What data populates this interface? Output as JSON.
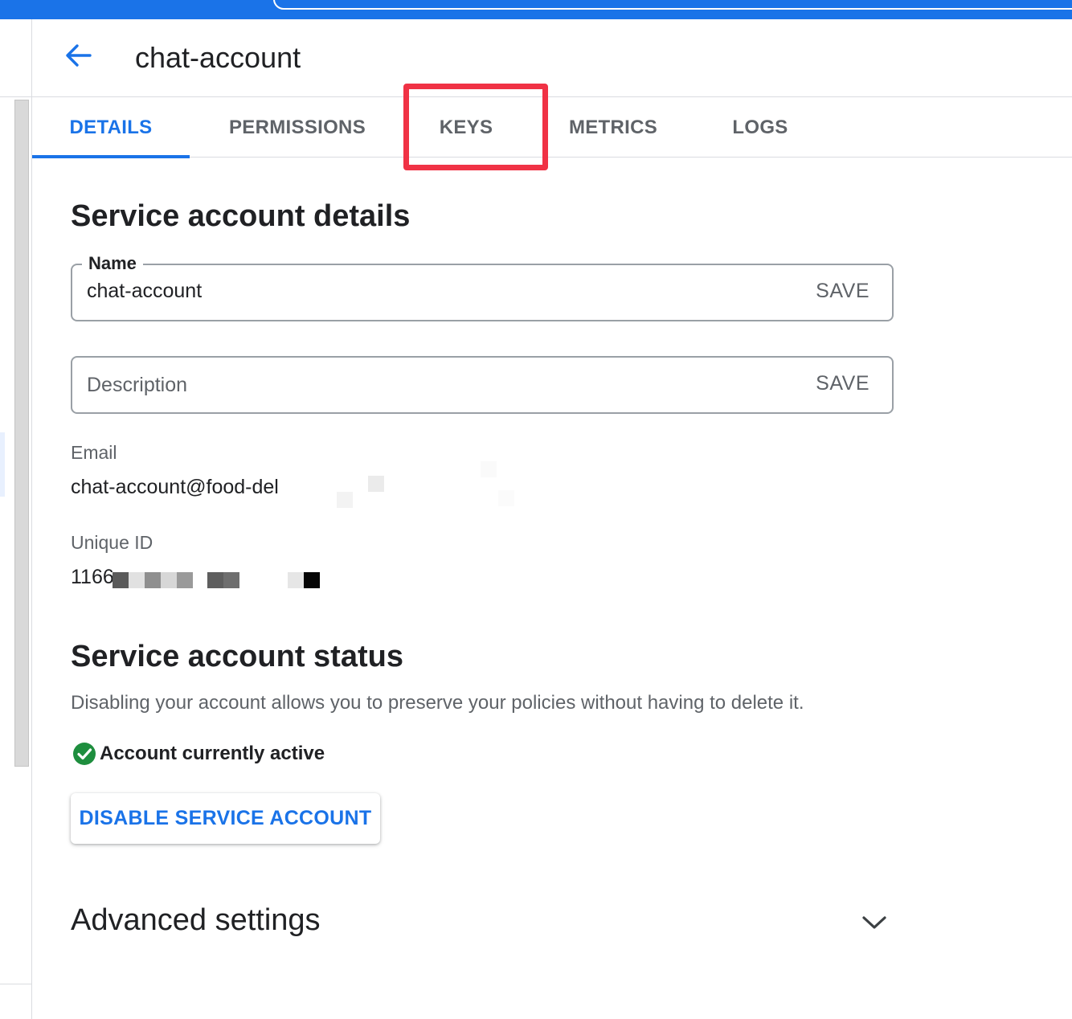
{
  "header": {
    "title": "chat-account",
    "back_icon": "arrow-back-icon"
  },
  "tabs": [
    {
      "label": "DETAILS",
      "active": true
    },
    {
      "label": "PERMISSIONS",
      "active": false
    },
    {
      "label": "KEYS",
      "active": false,
      "highlighted": true
    },
    {
      "label": "METRICS",
      "active": false
    },
    {
      "label": "LOGS",
      "active": false
    }
  ],
  "details": {
    "title": "Service account details",
    "name_field": {
      "label": "Name",
      "value": "chat-account",
      "save_label": "SAVE"
    },
    "description_field": {
      "placeholder": "Description",
      "save_label": "SAVE"
    },
    "email": {
      "label": "Email",
      "value": "chat-account@food-del"
    },
    "unique_id": {
      "label": "Unique ID",
      "value": "1166"
    }
  },
  "status": {
    "title": "Service account status",
    "description": "Disabling your account allows you to preserve your policies without having to delete it.",
    "state_text": "Account currently active",
    "state_icon": "check-circle-icon",
    "disable_button": "DISABLE SERVICE ACCOUNT"
  },
  "advanced": {
    "title": "Advanced settings",
    "expand_icon": "chevron-down-icon"
  },
  "colors": {
    "accent": "#1a73e8",
    "highlight": "#f03245",
    "success": "#1e8e3e"
  }
}
